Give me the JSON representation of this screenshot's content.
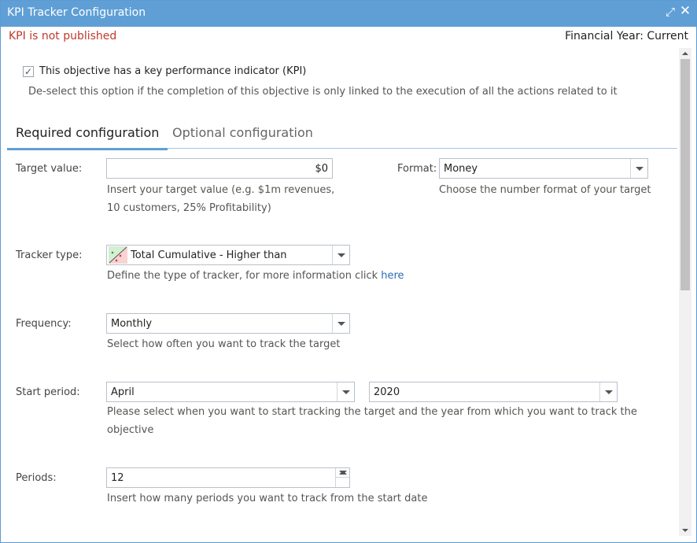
{
  "window": {
    "title": "KPI Tracker Configuration",
    "maximize_icon": "expand-icon",
    "close_icon": "close-icon"
  },
  "header": {
    "status": "KPI is not published",
    "financial_year": "Financial Year: Current"
  },
  "kpi": {
    "checked": true,
    "label": "This objective has a key performance indicator (KPI)",
    "description": "De-select this option if the completion of this objective is only linked to the execution of all the actions related to it"
  },
  "tabs": [
    {
      "label": "Required configuration",
      "active": true
    },
    {
      "label": "Optional configuration",
      "active": false
    }
  ],
  "form": {
    "target": {
      "label": "Target value:",
      "value": "$0",
      "help_line1": "Insert your target value (e.g. $1m revenues,",
      "help_line2": "10 customers, 25% Profitability)"
    },
    "format": {
      "label": "Format:",
      "value": "Money",
      "help": "Choose the number format of your target"
    },
    "tracker_type": {
      "label": "Tracker type:",
      "value": "Total Cumulative - Higher than",
      "help": "Define the type of tracker, for more information click",
      "help_link": "here"
    },
    "frequency": {
      "label": "Frequency:",
      "value": "Monthly",
      "help": "Select how often you want to track the target"
    },
    "start_period": {
      "label": "Start period:",
      "month": "April",
      "year": "2020",
      "help_line1": "Please select when you want to start tracking the target and the year from which you want to track the",
      "help_line2": "objective"
    },
    "periods": {
      "label": "Periods:",
      "value": "12",
      "help": "Insert how many periods you want to track from the start date"
    }
  },
  "colors": {
    "titlebar": "#5f9fd6",
    "status_text": "#c0392b",
    "link": "#2a6db8"
  }
}
